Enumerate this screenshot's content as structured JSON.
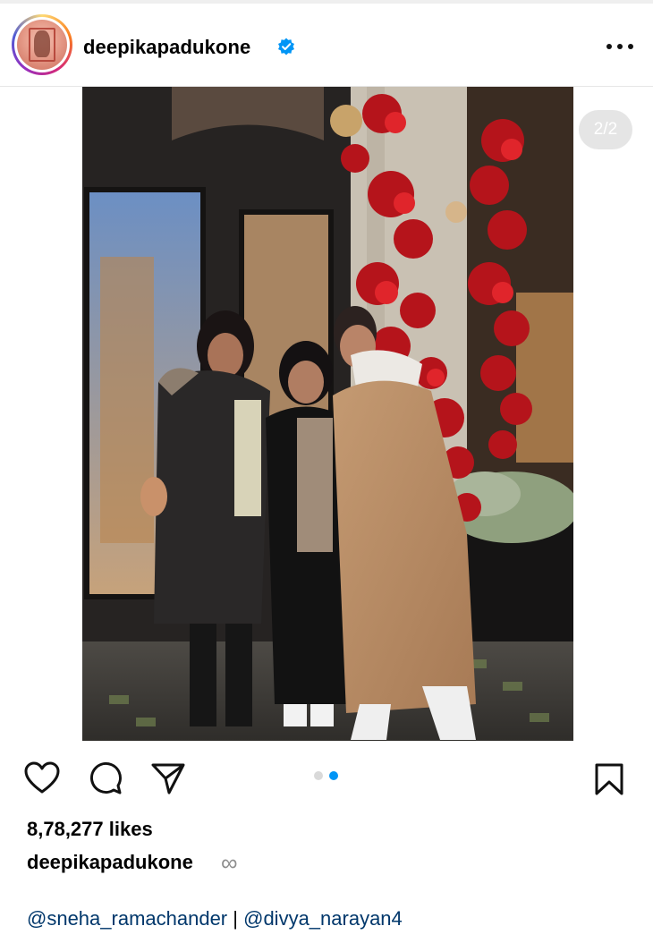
{
  "post": {
    "username": "deepikapadukone",
    "verified": true,
    "media_counter": "2/2",
    "carousel_total": 2,
    "carousel_active_index": 1,
    "likes": "8,78,277 likes",
    "caption_user": "deepikapadukone",
    "caption_symbol": "∞",
    "tag_1": "@sneha_ramachander",
    "tag_separator": "|",
    "tag_2": "@divya_narayan4"
  },
  "colors": {
    "verified_blue": "#0095f6",
    "dot_active": "#0095f6",
    "dot_inactive": "#d9d9d9",
    "link": "#00376b"
  },
  "icons": [
    "heart-icon",
    "comment-icon",
    "share-icon",
    "bookmark-icon",
    "more-icon",
    "verified-icon"
  ]
}
